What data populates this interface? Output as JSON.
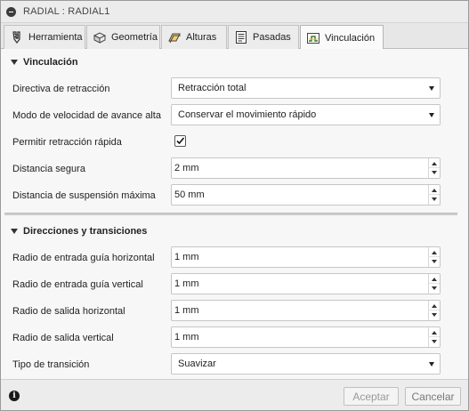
{
  "window": {
    "title": "RADIAL : RADIAL1"
  },
  "tabs": [
    {
      "label": "Herramienta",
      "icon": "tool-icon",
      "active": false
    },
    {
      "label": "Geometría",
      "icon": "geometry-icon",
      "active": false
    },
    {
      "label": "Alturas",
      "icon": "heights-icon",
      "active": false
    },
    {
      "label": "Pasadas",
      "icon": "passes-icon",
      "active": false
    },
    {
      "label": "Vinculación",
      "icon": "linking-icon",
      "active": true
    }
  ],
  "sections": {
    "vinculacion": {
      "title": "Vinculación",
      "retract_policy": {
        "label": "Directiva de retracción",
        "value": "Retracción total"
      },
      "feed_mode": {
        "label": "Modo de velocidad de avance alta",
        "value": "Conservar el movimiento rápido"
      },
      "rapid_retract": {
        "label": "Permitir retracción rápida",
        "checked": true
      },
      "safe_distance": {
        "label": "Distancia segura",
        "value": "2 mm"
      },
      "max_stay_down": {
        "label": "Distancia de suspensión máxima",
        "value": "50 mm"
      }
    },
    "transitions": {
      "title": "Direcciones y transiciones",
      "lead_in_horizontal": {
        "label": "Radio de entrada guía horizontal",
        "value": "1 mm"
      },
      "lead_in_vertical": {
        "label": "Radio de entrada guía vertical",
        "value": "1 mm"
      },
      "lead_out_horizontal": {
        "label": "Radio de salida horizontal",
        "value": "1 mm"
      },
      "lead_out_vertical": {
        "label": "Radio de salida vertical",
        "value": "1 mm"
      },
      "transition_type": {
        "label": "Tipo de transición",
        "value": "Suavizar"
      }
    }
  },
  "footer": {
    "info_icon": "info-icon",
    "info_glyph": "i",
    "accept_label": "Aceptar",
    "cancel_label": "Cancelar"
  }
}
